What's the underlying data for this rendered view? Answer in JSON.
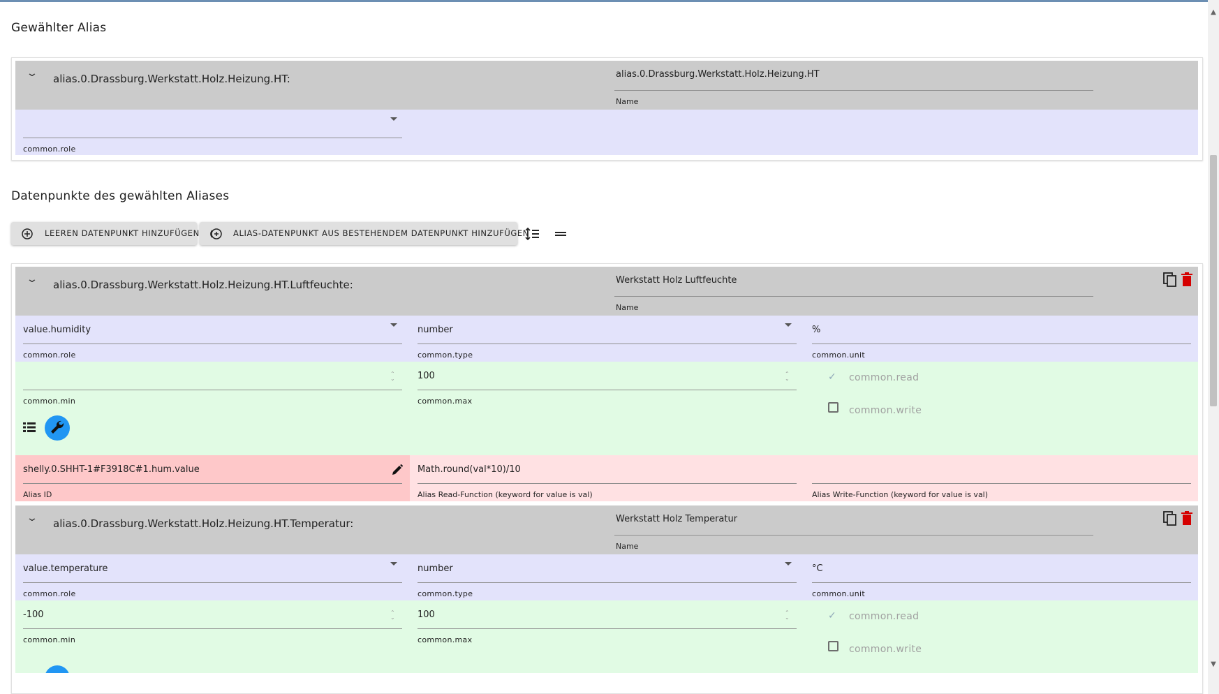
{
  "selected_alias": {
    "heading": "Gewählter Alias",
    "title": "alias.0.Drassburg.Werkstatt.Holz.Heizung.HT:",
    "name_value": "alias.0.Drassburg.Werkstatt.Holz.Heizung.HT",
    "name_label": "Name",
    "role_value": "",
    "role_label": "common.role"
  },
  "datapoints_heading": "Datenpunkte des gewählten Aliases",
  "toolbar": {
    "add_empty_label": "LEEREN DATENPUNKT HINZUFÜGEN",
    "add_from_existing_label": "ALIAS-DATENPUNKT AUS BESTEHENDEM DATENPUNKT HINZUFÜGEN"
  },
  "datapoints": [
    {
      "title": "alias.0.Drassburg.Werkstatt.Holz.Heizung.HT.Luftfeuchte:",
      "name_value": "Werkstatt Holz Luftfeuchte",
      "name_label": "Name",
      "role_value": "value.humidity",
      "role_label": "common.role",
      "type_value": "number",
      "type_label": "common.type",
      "unit_value": "%",
      "unit_label": "common.unit",
      "min_value": "",
      "min_label": "common.min",
      "max_value": "100",
      "max_label": "common.max",
      "read_label": "common.read",
      "read_checked": true,
      "write_label": "common.write",
      "write_checked": false,
      "alias_id_value": "shelly.0.SHHT-1#F3918C#1.hum.value",
      "alias_id_label": "Alias ID",
      "read_fn_value": "Math.round(val*10)/10",
      "read_fn_label": "Alias Read-Function (keyword for value is val)",
      "write_fn_value": "",
      "write_fn_label": "Alias Write-Function (keyword for value is val)"
    },
    {
      "title": "alias.0.Drassburg.Werkstatt.Holz.Heizung.HT.Temperatur:",
      "name_value": "Werkstatt Holz Temperatur",
      "name_label": "Name",
      "role_value": "value.temperature",
      "role_label": "common.role",
      "type_value": "number",
      "type_label": "common.type",
      "unit_value": "°C",
      "unit_label": "common.unit",
      "min_value": "-100",
      "min_label": "common.min",
      "max_value": "100",
      "max_label": "common.max",
      "read_label": "common.read",
      "read_checked": true,
      "write_label": "common.write",
      "write_checked": false
    }
  ],
  "icons": {
    "expand": "chevron-down-icon",
    "copy": "copy-icon",
    "delete": "delete-icon",
    "edit": "pencil-icon",
    "list": "list-icon",
    "wrench": "wrench-icon",
    "add": "add-circle-icon",
    "sort": "sort-icon",
    "collapse": "equals-icon"
  },
  "colors": {
    "header_bg": "#cbcbcb",
    "blue_row": "#e3e3fb",
    "green_row": "#e1fbe4",
    "red_row": "#ffe1e3",
    "alias_id_bg": "#fec8c9",
    "accent": "#2196f3",
    "delete": "#d50000"
  }
}
